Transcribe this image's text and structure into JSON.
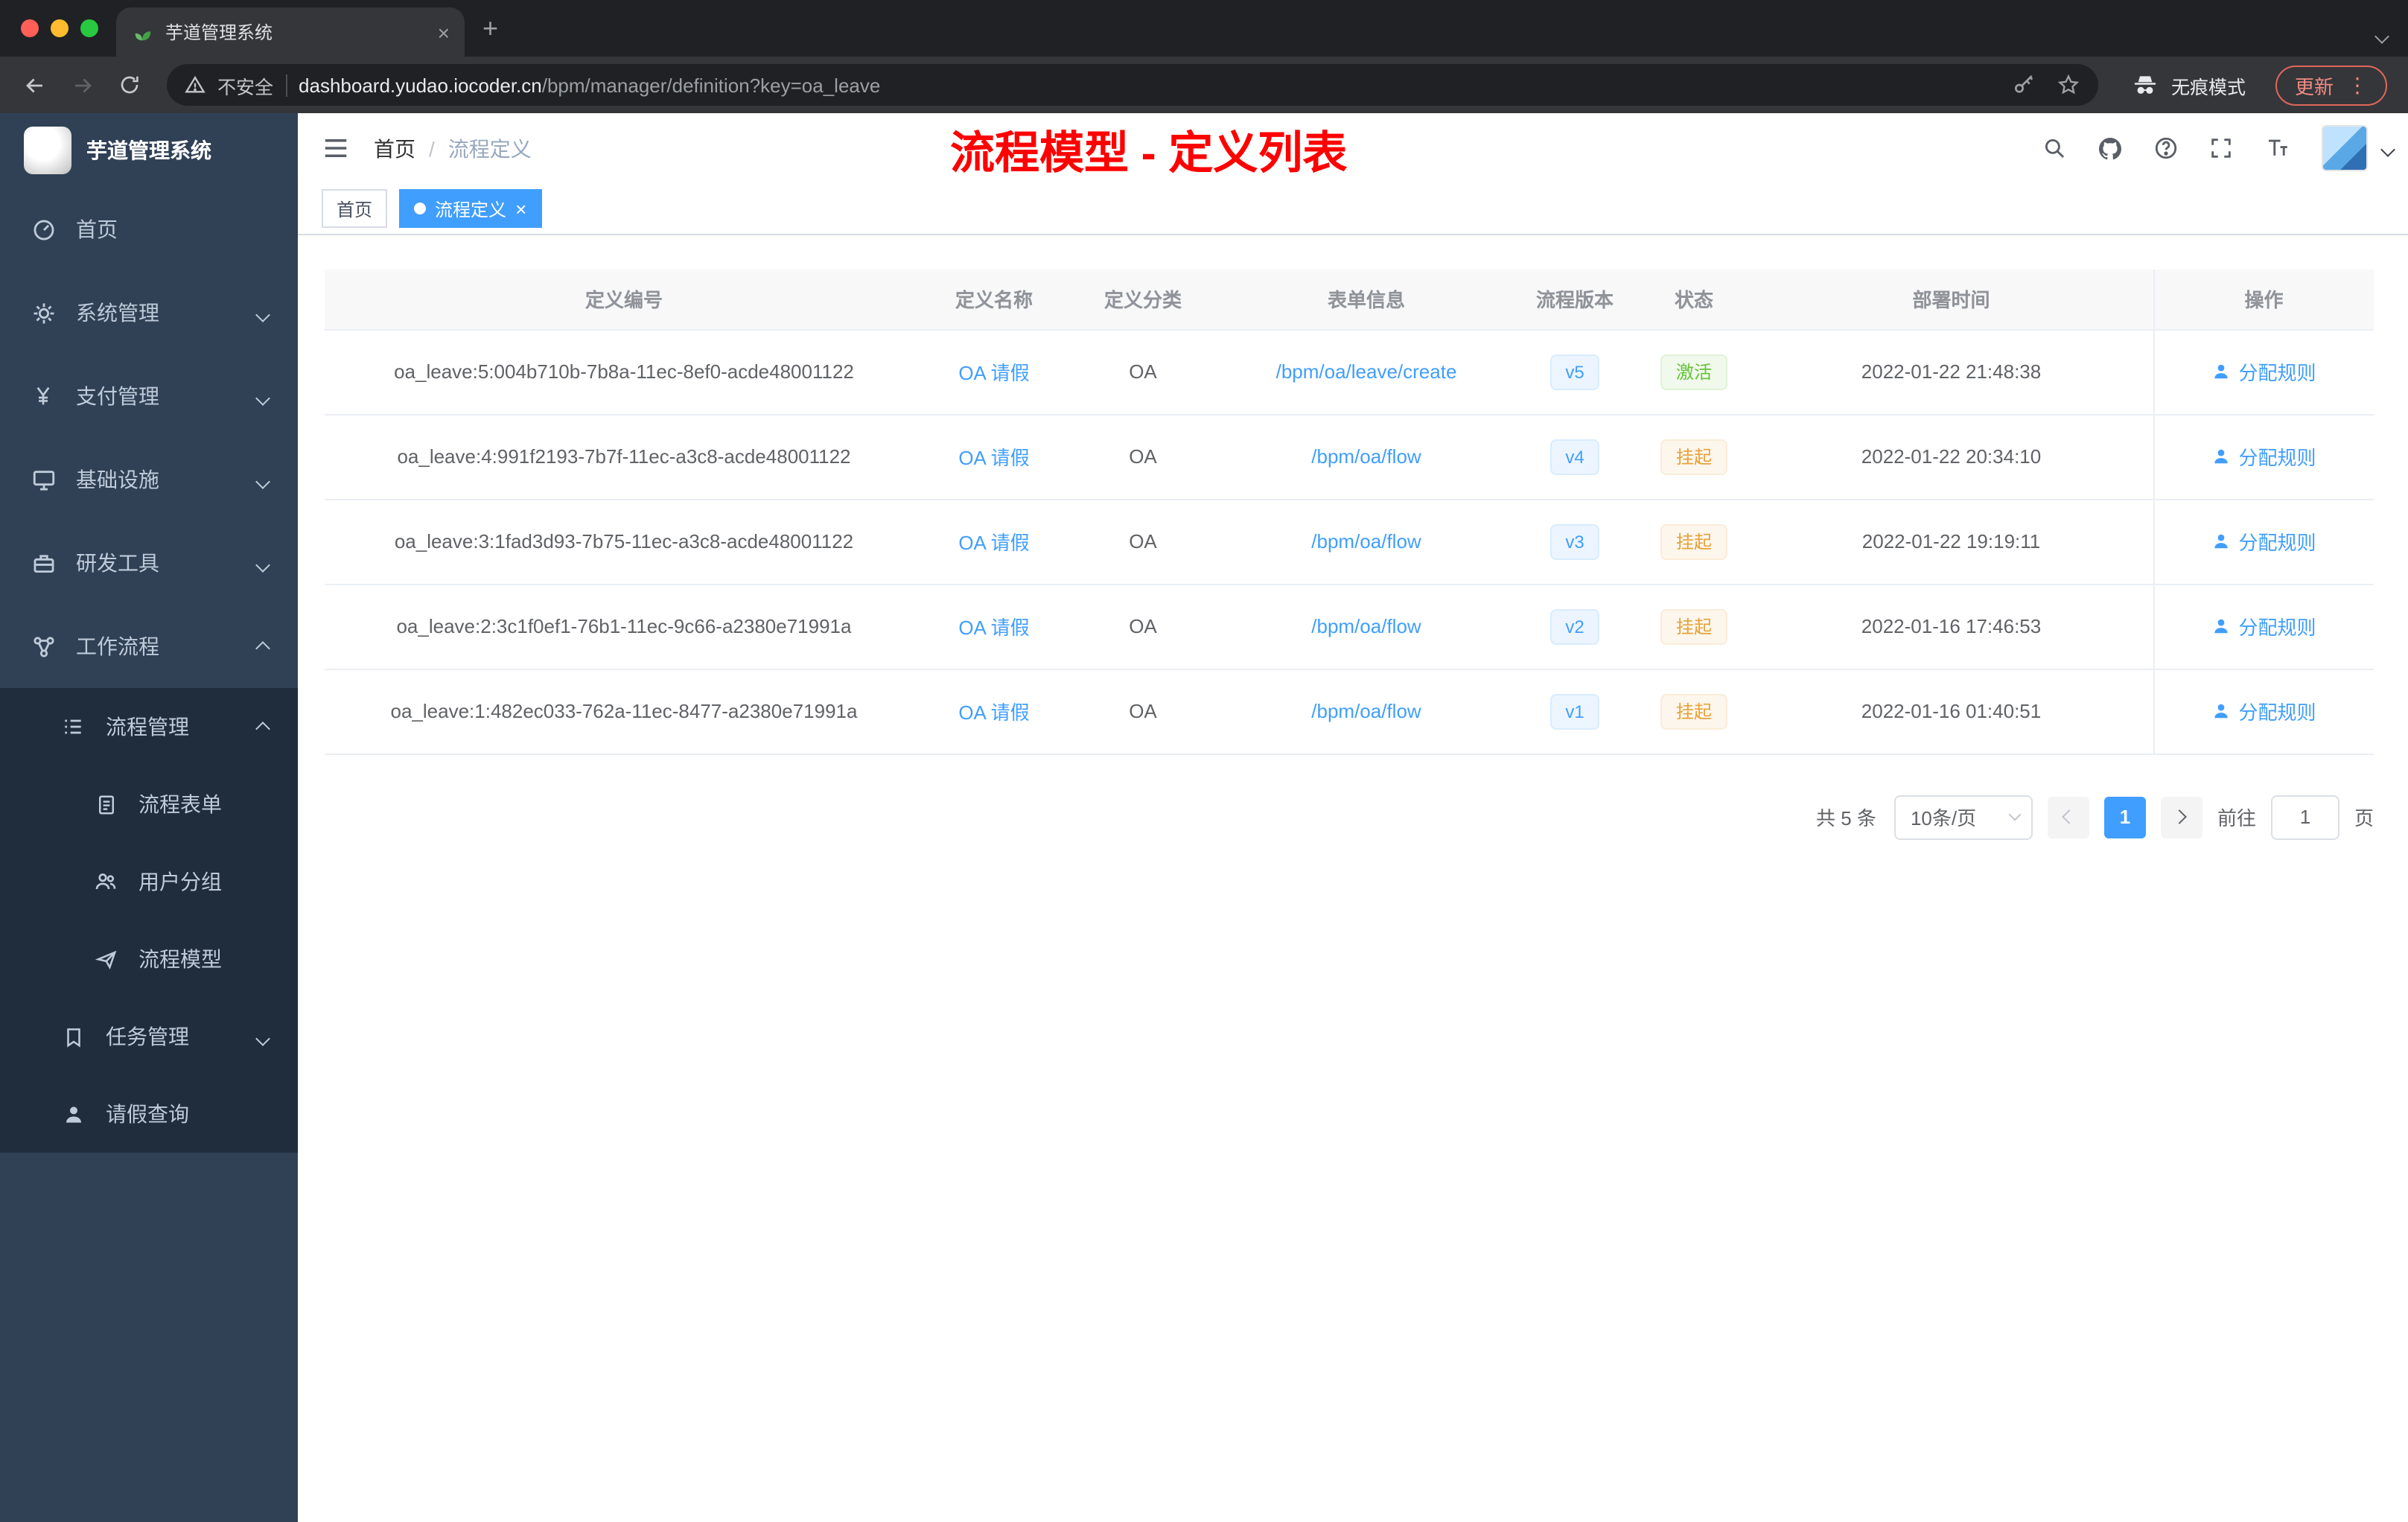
{
  "colors": {
    "accent": "#409eff",
    "success": "#67c23a",
    "warning": "#e6a23c",
    "annotation_red": "#fe0000",
    "sidebar_bg": "#304156",
    "submenu_bg": "#1f2d3d"
  },
  "browser": {
    "tab_title": "芋道管理系统",
    "close_tab": "×",
    "new_tab": "+",
    "security_label": "不安全",
    "url_host": "dashboard.yudao.iocoder.cn",
    "url_path": "/bpm/manager/definition?key=oa_leave",
    "incognito_label": "无痕模式",
    "update_label": "更新",
    "menu_dots": "⋮"
  },
  "sidebar": {
    "logo_title": "芋道管理系统",
    "menu": [
      {
        "label": "首页"
      },
      {
        "label": "系统管理"
      },
      {
        "label": "支付管理"
      },
      {
        "label": "基础设施"
      },
      {
        "label": "研发工具"
      },
      {
        "label": "工作流程"
      }
    ],
    "submenu": {
      "process_management": "流程管理",
      "process_form": "流程表单",
      "user_group": "用户分组",
      "process_model": "流程模型",
      "task_management": "任务管理",
      "leave_query": "请假查询"
    }
  },
  "header": {
    "breadcrumb_home": "首页",
    "breadcrumb_sep": "/",
    "breadcrumb_current": "流程定义",
    "annotation": "流程模型 - 定义列表"
  },
  "tags": {
    "home": "首页",
    "active": "流程定义",
    "close": "×"
  },
  "table": {
    "columns": [
      "定义编号",
      "定义名称",
      "定义分类",
      "表单信息",
      "流程版本",
      "状态",
      "部署时间",
      "操作"
    ],
    "rows": [
      {
        "id": "oa_leave:5:004b710b-7b8a-11ec-8ef0-acde48001122",
        "name": "OA 请假",
        "category": "OA",
        "form": "/bpm/oa/leave/create",
        "version": "v5",
        "status": "激活",
        "time": "2022-01-22 21:48:38",
        "action": "分配规则"
      },
      {
        "id": "oa_leave:4:991f2193-7b7f-11ec-a3c8-acde48001122",
        "name": "OA 请假",
        "category": "OA",
        "form": "/bpm/oa/flow",
        "version": "v4",
        "status": "挂起",
        "time": "2022-01-22 20:34:10",
        "action": "分配规则"
      },
      {
        "id": "oa_leave:3:1fad3d93-7b75-11ec-a3c8-acde48001122",
        "name": "OA 请假",
        "category": "OA",
        "form": "/bpm/oa/flow",
        "version": "v3",
        "status": "挂起",
        "time": "2022-01-22 19:19:11",
        "action": "分配规则"
      },
      {
        "id": "oa_leave:2:3c1f0ef1-76b1-11ec-9c66-a2380e71991a",
        "name": "OA 请假",
        "category": "OA",
        "form": "/bpm/oa/flow",
        "version": "v2",
        "status": "挂起",
        "time": "2022-01-16 17:46:53",
        "action": "分配规则"
      },
      {
        "id": "oa_leave:1:482ec033-762a-11ec-8477-a2380e71991a",
        "name": "OA 请假",
        "category": "OA",
        "form": "/bpm/oa/flow",
        "version": "v1",
        "status": "挂起",
        "time": "2022-01-16 01:40:51",
        "action": "分配规则"
      }
    ]
  },
  "pagination": {
    "total": "共 5 条",
    "page_size": "10条/页",
    "current_page": "1",
    "goto_label": "前往",
    "goto_value": "1",
    "page_unit": "页"
  }
}
